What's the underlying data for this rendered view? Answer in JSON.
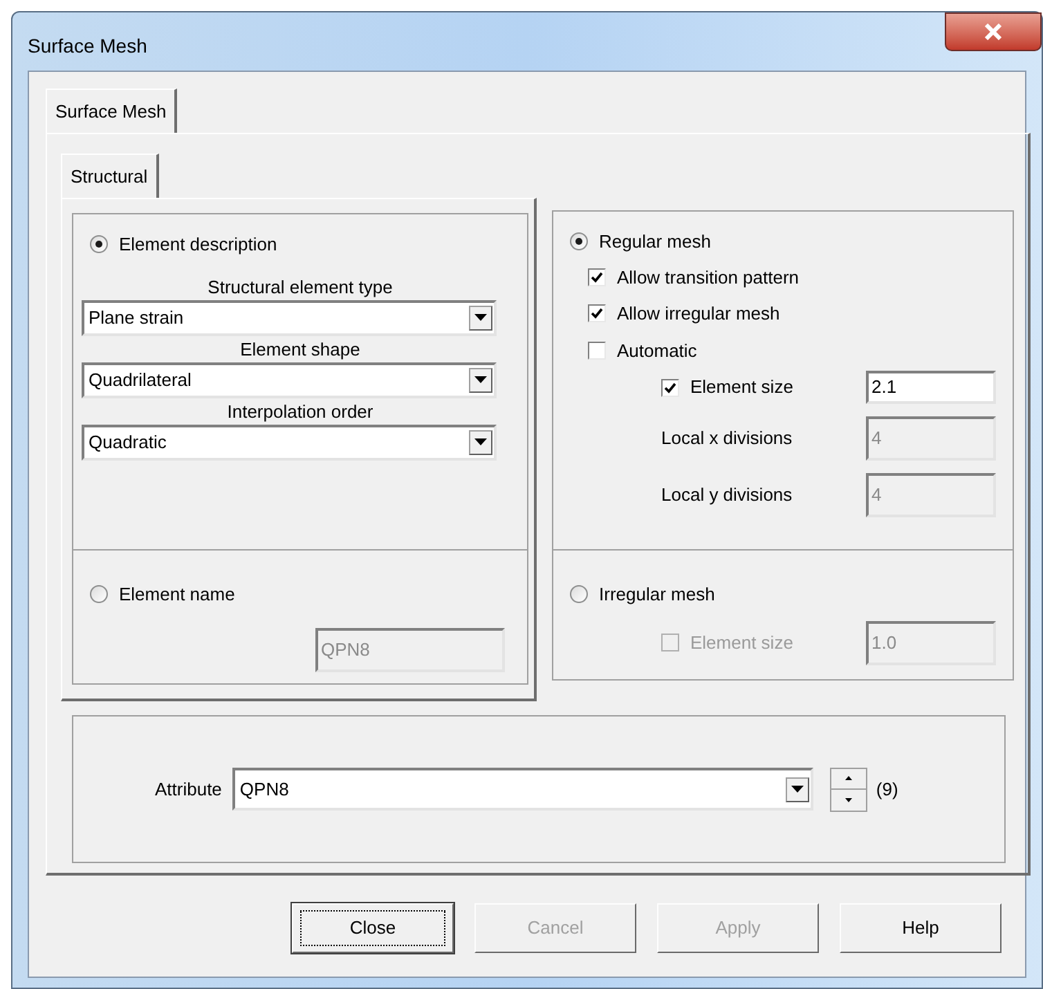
{
  "window": {
    "title": "Surface Mesh"
  },
  "tabs": [
    {
      "label": "Surface Mesh",
      "selected": true
    }
  ],
  "subtabs": [
    {
      "label": "Structural",
      "selected": true
    }
  ],
  "element_description": {
    "label": "Element description",
    "selected": true,
    "fields": [
      {
        "label": "Structural element type",
        "value": "Plane strain"
      },
      {
        "label": "Element shape",
        "value": "Quadrilateral"
      },
      {
        "label": "Interpolation order",
        "value": "Quadratic"
      }
    ]
  },
  "element_name": {
    "label": "Element name",
    "selected": false,
    "value": "QPN8",
    "disabled": true
  },
  "regular_mesh": {
    "label": "Regular mesh",
    "selected": true,
    "options": [
      {
        "label": "Allow transition pattern",
        "checked": true
      },
      {
        "label": "Allow irregular mesh",
        "checked": true
      },
      {
        "label": "Automatic",
        "checked": false
      }
    ],
    "element_size": {
      "label": "Element size",
      "checked": true,
      "disabled": false,
      "value": "2.1"
    },
    "divisions": [
      {
        "label": "Local x divisions",
        "value": "4",
        "disabled": true
      },
      {
        "label": "Local y divisions",
        "value": "4",
        "disabled": true
      }
    ]
  },
  "irregular_mesh": {
    "label": "Irregular mesh",
    "selected": false,
    "element_size": {
      "label": "Element size",
      "checked": false,
      "disabled": true,
      "value": "1.0"
    }
  },
  "attribute": {
    "label": "Attribute",
    "value": "QPN8",
    "count": "(9)"
  },
  "buttons": [
    {
      "label": "Close",
      "disabled": false,
      "focused": true
    },
    {
      "label": "Cancel",
      "disabled": true,
      "focused": false
    },
    {
      "label": "Apply",
      "disabled": true,
      "focused": false
    },
    {
      "label": "Help",
      "disabled": false,
      "focused": false
    }
  ]
}
